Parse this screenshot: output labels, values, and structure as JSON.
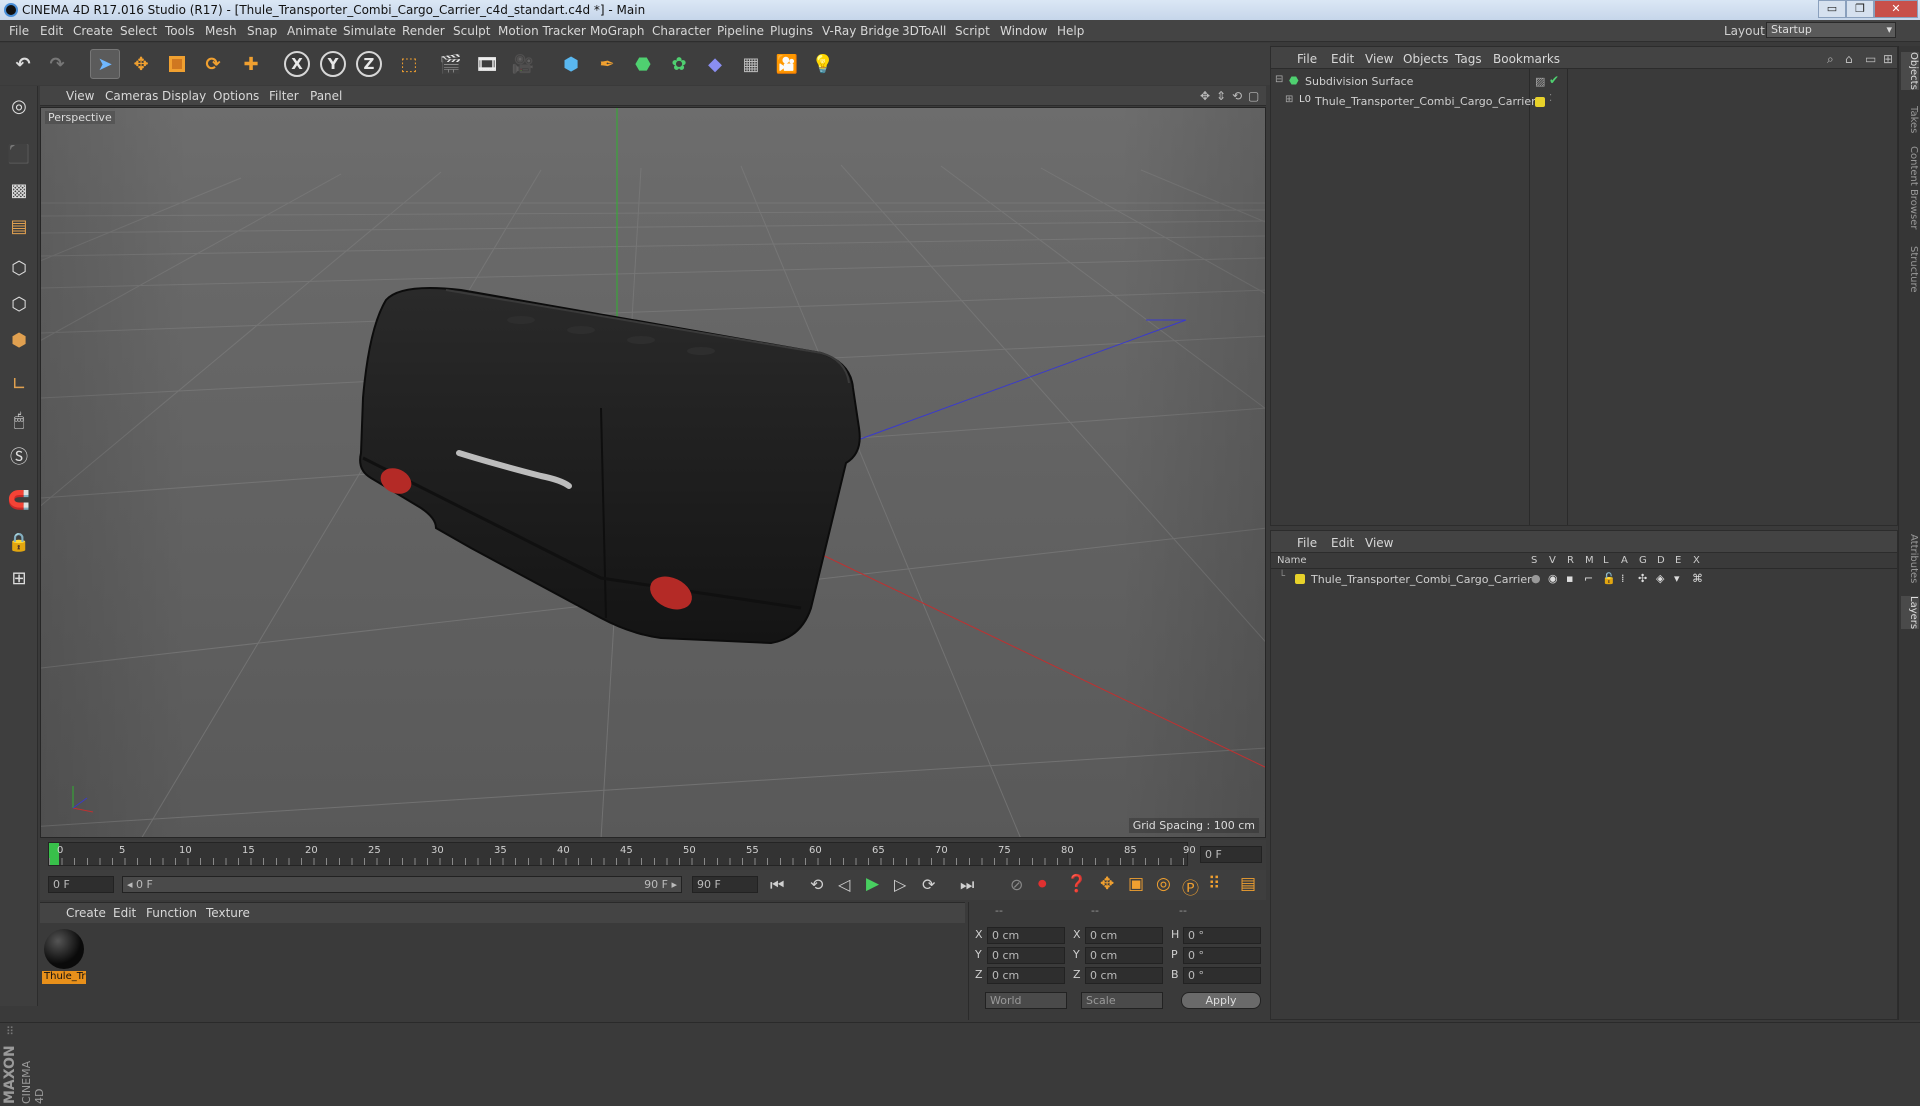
{
  "window": {
    "title": "CINEMA 4D R17.016 Studio (R17) - [Thule_Transporter_Combi_Cargo_Carrier_c4d_standart.c4d *] - Main",
    "minimize": "▭",
    "maximize": "❐",
    "close": "✕"
  },
  "menubar": {
    "items": [
      "File",
      "Edit",
      "Create",
      "Select",
      "Tools",
      "Mesh",
      "Snap",
      "Animate",
      "Simulate",
      "Render",
      "Sculpt",
      "Motion Tracker",
      "MoGraph",
      "Character",
      "Pipeline",
      "Plugins",
      "V-Ray Bridge",
      "3DToAll",
      "Script",
      "Window",
      "Help"
    ],
    "layout_label": "Layout:",
    "layout_value": "Startup"
  },
  "toolbar": {
    "axis_x": "X",
    "axis_y": "Y",
    "axis_z": "Z"
  },
  "viewport": {
    "menu": [
      "View",
      "Cameras",
      "Display",
      "Options",
      "Filter",
      "Panel"
    ],
    "label": "Perspective",
    "grid_spacing": "Grid Spacing : 100 cm",
    "colors": {
      "floor": "#5a5a5a",
      "horizon": "#6f6f6f",
      "grid": "#7a7a7a",
      "object": "#1e1e1e",
      "light_red": "#b42a26",
      "x_axis": "#c03030",
      "y_axis": "#30b030",
      "z_axis": "#3a3acc"
    }
  },
  "timeline": {
    "ticks": [
      "0",
      "5",
      "10",
      "15",
      "20",
      "25",
      "30",
      "35",
      "40",
      "45",
      "50",
      "55",
      "60",
      "65",
      "70",
      "75",
      "80",
      "85",
      "90"
    ],
    "current_frame": "0 F"
  },
  "transport": {
    "start_field": "0 F",
    "range_start": "◂ 0 F",
    "range_end": "90 F ▸",
    "end_field": "90 F"
  },
  "material_panel": {
    "menu": [
      "Create",
      "Edit",
      "Function",
      "Texture"
    ],
    "material_name": "Thule_Tr"
  },
  "coord_panel": {
    "headers": [
      "--",
      "--",
      "--"
    ],
    "rows": [
      {
        "a": "X",
        "av": "0 cm",
        "b": "X",
        "bv": "0 cm",
        "c": "H",
        "cv": "0 °"
      },
      {
        "a": "Y",
        "av": "0 cm",
        "b": "Y",
        "bv": "0 cm",
        "c": "P",
        "cv": "0 °"
      },
      {
        "a": "Z",
        "av": "0 cm",
        "b": "Z",
        "bv": "0 cm",
        "c": "B",
        "cv": "0 °"
      }
    ],
    "world": "World",
    "scale": "Scale",
    "apply": "Apply"
  },
  "object_manager": {
    "menu": [
      "File",
      "Edit",
      "View",
      "Objects",
      "Tags",
      "Bookmarks"
    ],
    "objects": [
      {
        "name": "Subdivision Surface",
        "indent": 0
      },
      {
        "name": "Thule_Transporter_Combi_Cargo_Carrier",
        "indent": 1
      }
    ]
  },
  "layer_manager": {
    "menu": [
      "File",
      "Edit",
      "View"
    ],
    "col_name": "Name",
    "cols": [
      "S",
      "V",
      "R",
      "M",
      "L",
      "A",
      "G",
      "D",
      "E",
      "X"
    ],
    "layers": [
      {
        "name": "Thule_Transporter_Combi_Cargo_Carrier",
        "color": "#e8d22a"
      }
    ]
  },
  "right_tabs": [
    "Objects",
    "Takes",
    "Content Browser",
    "Structure",
    "Attributes",
    "Layers"
  ],
  "branding": {
    "maxon": "MAXON",
    "cinema": "CINEMA 4D"
  }
}
